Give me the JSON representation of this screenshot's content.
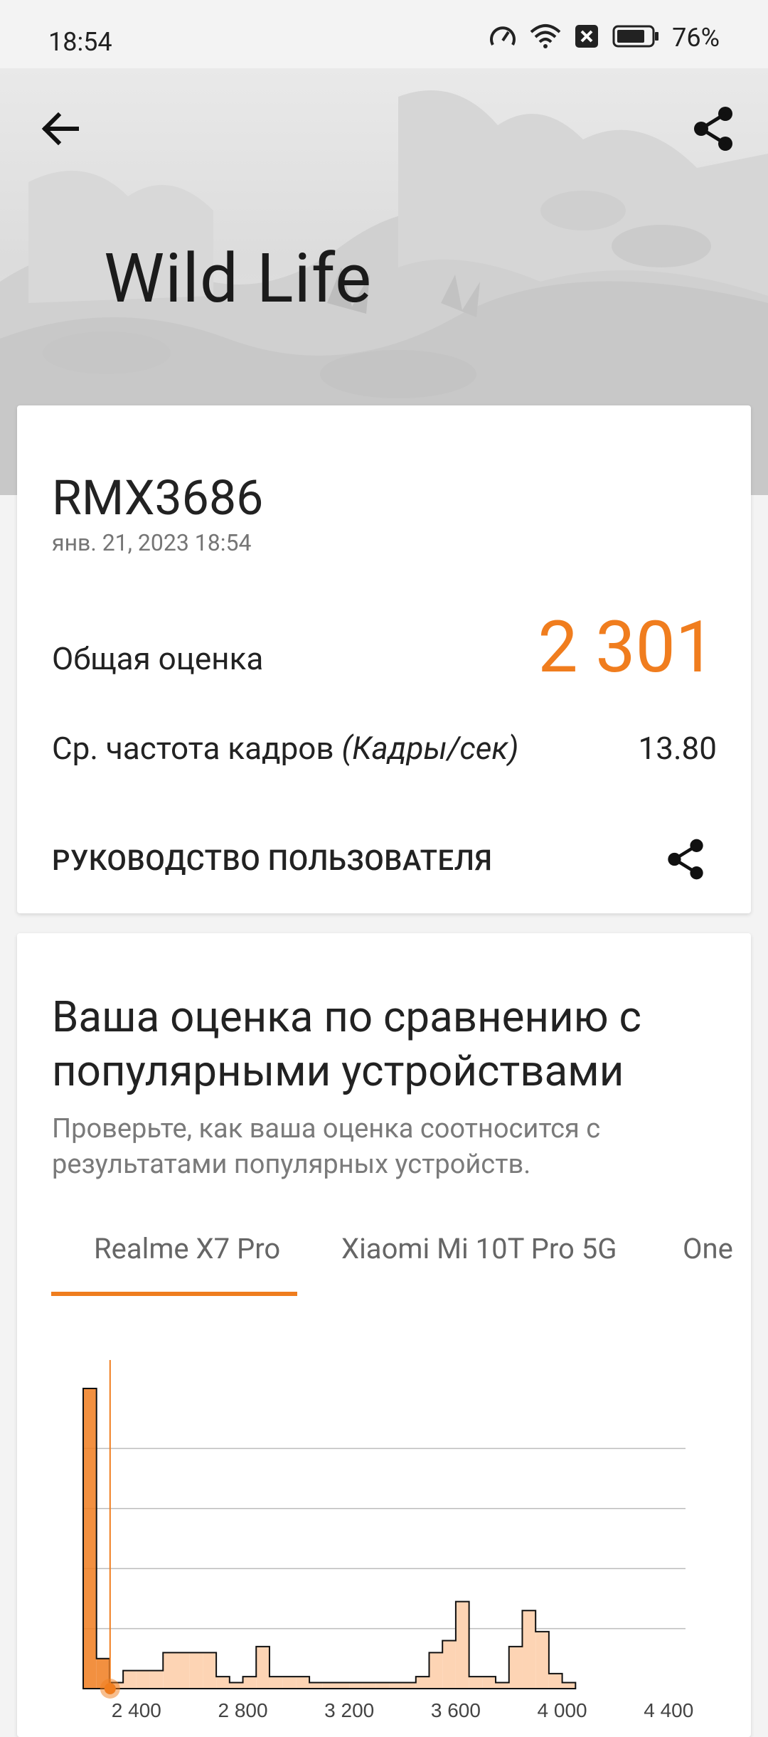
{
  "status": {
    "time": "18:54",
    "battery": "76%"
  },
  "hero": {
    "title": "Wild Life"
  },
  "result": {
    "device": "RMX3686",
    "date": "янв. 21, 2023 18:54",
    "overall_label": "Общая оценка",
    "overall_score": "2 301",
    "fps_label": "Ср. частота кадров",
    "fps_unit": "(Кадры/сек)",
    "fps_value": "13.80",
    "guide_label": "РУКОВОДСТВО ПОЛЬЗОВАТЕЛЯ"
  },
  "comparison": {
    "title": "Ваша оценка по сравнению с популярными устройствами",
    "subtitle": "Проверьте, как ваша оценка соотносится с результатами популярных устройств.",
    "tabs": [
      "Realme X7 Pro",
      "Xiaomi Mi 10T Pro 5G",
      "One"
    ]
  },
  "colors": {
    "accent": "#f07d1e",
    "histogram_fill": "#fdd4b4"
  },
  "icons": [
    "back-arrow-icon",
    "share-icon",
    "speedometer-icon",
    "wifi-icon",
    "notification-x-icon",
    "battery-icon"
  ],
  "chart_data": {
    "type": "bar",
    "xlim": [
      2200,
      4450
    ],
    "x_ticks": [
      "2 400",
      "2 800",
      "3 200",
      "3 600",
      "4 000",
      "4 400"
    ],
    "x_tick_values": [
      2400,
      2800,
      3200,
      3600,
      4000,
      4400
    ],
    "marker_score": 2301,
    "bins": [
      [
        2200,
        2250,
        100
      ],
      [
        2250,
        2300,
        10
      ],
      [
        2300,
        2350,
        2
      ],
      [
        2350,
        2400,
        6
      ],
      [
        2400,
        2450,
        6
      ],
      [
        2450,
        2500,
        6
      ],
      [
        2500,
        2550,
        12
      ],
      [
        2550,
        2600,
        12
      ],
      [
        2600,
        2650,
        12
      ],
      [
        2650,
        2700,
        12
      ],
      [
        2700,
        2750,
        4
      ],
      [
        2750,
        2800,
        2
      ],
      [
        2800,
        2850,
        4
      ],
      [
        2850,
        2900,
        14
      ],
      [
        2900,
        2950,
        4
      ],
      [
        2950,
        3000,
        4
      ],
      [
        3000,
        3050,
        4
      ],
      [
        3050,
        3100,
        2
      ],
      [
        3100,
        3150,
        2
      ],
      [
        3150,
        3200,
        2
      ],
      [
        3200,
        3250,
        2
      ],
      [
        3250,
        3300,
        2
      ],
      [
        3300,
        3350,
        2
      ],
      [
        3350,
        3400,
        2
      ],
      [
        3400,
        3450,
        2
      ],
      [
        3450,
        3500,
        4
      ],
      [
        3500,
        3550,
        12
      ],
      [
        3550,
        3600,
        16
      ],
      [
        3600,
        3650,
        29
      ],
      [
        3650,
        3700,
        4
      ],
      [
        3700,
        3750,
        4
      ],
      [
        3750,
        3800,
        2
      ],
      [
        3800,
        3850,
        14
      ],
      [
        3850,
        3900,
        26
      ],
      [
        3900,
        3950,
        19
      ],
      [
        3950,
        4000,
        5
      ],
      [
        4000,
        4050,
        2
      ]
    ]
  }
}
